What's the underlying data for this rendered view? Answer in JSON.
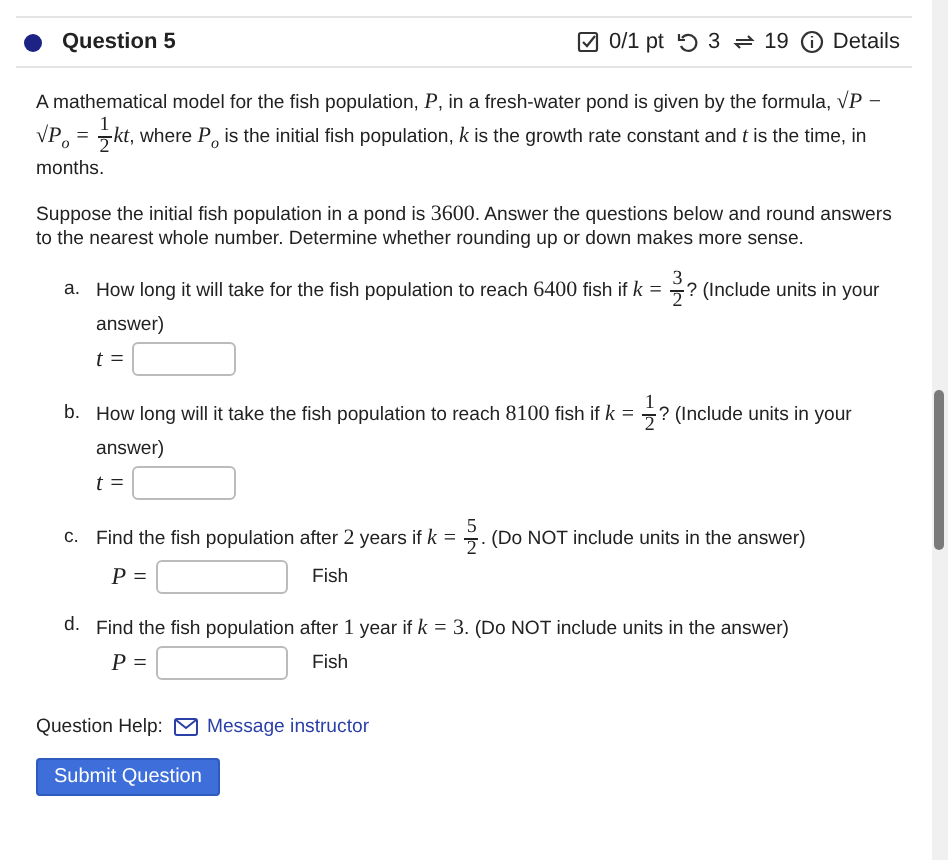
{
  "question": {
    "title": "Question 5",
    "score": "0/1 pt",
    "retries": "3",
    "attempts": "19",
    "details": "Details"
  },
  "intro": [
    {
      "kind": "text",
      "text": "A mathematical model for the fish population, "
    },
    {
      "kind": "math",
      "text": "P"
    },
    {
      "kind": "text",
      "text": ", in a fresh-water pond is given by the formula, "
    },
    {
      "kind": "math",
      "text": "√P − √P"
    },
    {
      "kind": "sub",
      "text": "o"
    },
    {
      "kind": "math",
      "text": " = "
    },
    {
      "kind": "frac",
      "num": "1",
      "den": "2"
    },
    {
      "kind": "math",
      "text": "kt"
    },
    {
      "kind": "text",
      "text": ", where "
    },
    {
      "kind": "math",
      "text": "P"
    },
    {
      "kind": "sub",
      "text": "o"
    },
    {
      "kind": "text",
      "text": " is the initial fish population, "
    },
    {
      "kind": "math",
      "text": "k"
    },
    {
      "kind": "text",
      "text": " is the growth rate constant and "
    },
    {
      "kind": "math",
      "text": "t"
    },
    {
      "kind": "text",
      "text": " is the time, in months."
    }
  ],
  "setup": [
    {
      "kind": "text",
      "text": "Suppose the initial fish population in a pond is "
    },
    {
      "kind": "num",
      "text": "3600"
    },
    {
      "kind": "text",
      "text": ". Answer the questions below and round answers to the nearest whole number. Determine whether rounding up or down makes more sense."
    }
  ],
  "parts": [
    {
      "letter": "a.",
      "prompt": [
        {
          "kind": "text",
          "text": "How long it will take for the fish population to reach "
        },
        {
          "kind": "num",
          "text": "6400"
        },
        {
          "kind": "text",
          "text": " fish if "
        },
        {
          "kind": "math",
          "text": "k = "
        },
        {
          "kind": "frac",
          "num": "3",
          "den": "2"
        },
        {
          "kind": "text",
          "text": "? (Include units in your answer)"
        }
      ],
      "variable": "t ="
    },
    {
      "letter": "b.",
      "prompt": [
        {
          "kind": "text",
          "text": "How long will it take the fish population to reach "
        },
        {
          "kind": "num",
          "text": "8100"
        },
        {
          "kind": "text",
          "text": " fish if "
        },
        {
          "kind": "math",
          "text": "k = "
        },
        {
          "kind": "frac",
          "num": "1",
          "den": "2"
        },
        {
          "kind": "text",
          "text": "? (Include units in your answer)"
        }
      ],
      "variable": "t ="
    },
    {
      "letter": "c.",
      "prompt": [
        {
          "kind": "text",
          "text": "Find the fish population after "
        },
        {
          "kind": "num",
          "text": "2"
        },
        {
          "kind": "text",
          "text": " years if "
        },
        {
          "kind": "math",
          "text": "k = "
        },
        {
          "kind": "frac",
          "num": "5",
          "den": "2"
        },
        {
          "kind": "text",
          "text": ". (Do NOT include units in the answer)"
        }
      ],
      "variable": "P =",
      "unit": "Fish"
    },
    {
      "letter": "d.",
      "prompt": [
        {
          "kind": "text",
          "text": "Find the fish population after "
        },
        {
          "kind": "num",
          "text": "1"
        },
        {
          "kind": "text",
          "text": " year if "
        },
        {
          "kind": "math",
          "text": "k = "
        },
        {
          "kind": "num",
          "text": "3"
        },
        {
          "kind": "text",
          "text": ". (Do NOT include units in the answer)"
        }
      ],
      "variable": "P =",
      "unit": "Fish"
    }
  ],
  "help": {
    "label": "Question Help:",
    "link": "Message instructor"
  },
  "submit": "Submit Question"
}
